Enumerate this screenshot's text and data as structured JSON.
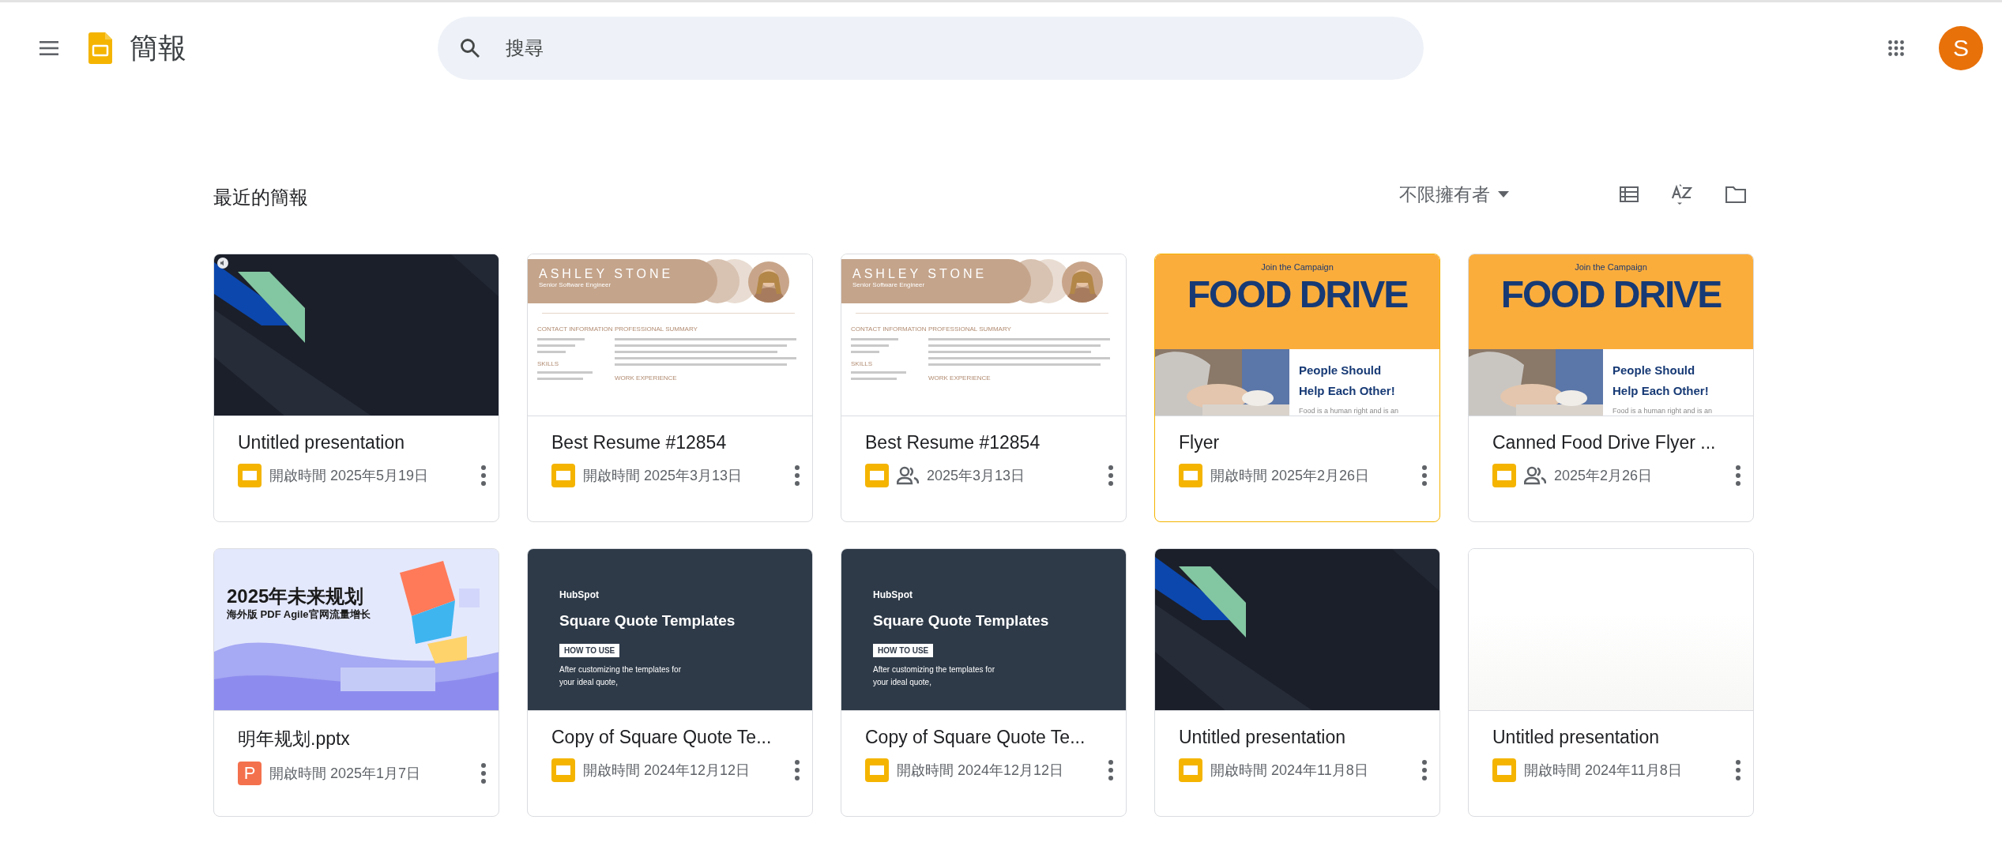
{
  "app": {
    "title": "簡報"
  },
  "search": {
    "placeholder": "搜尋"
  },
  "avatar": {
    "letter": "S",
    "color": "#e8710a"
  },
  "section": {
    "title": "最近的簡報",
    "owner_filter": "不限擁有者"
  },
  "cards": [
    {
      "title": "Untitled presentation",
      "kind": "slides",
      "shared": false,
      "date": "開啟時間 2025年5月19日",
      "selected": false,
      "thumbnail": {
        "kind": "dark",
        "audio": true
      }
    },
    {
      "title": "Best Resume #12854",
      "kind": "slides",
      "shared": false,
      "date": "開啟時間 2025年3月13日",
      "selected": false,
      "thumbnail": {
        "kind": "resume",
        "name": "ASHLEY STONE",
        "subtitle": "Senior Software Engineer",
        "left_heading": "CONTACT INFORMATION",
        "right_heading": "PROFESSIONAL SUMMARY",
        "skills": "SKILLS",
        "work": "WORK EXPERIENCE"
      }
    },
    {
      "title": "Best Resume #12854",
      "kind": "slides",
      "shared": true,
      "date": "2025年3月13日",
      "selected": false,
      "thumbnail": {
        "kind": "resume",
        "name": "ASHLEY STONE",
        "subtitle": "Senior Software Engineer",
        "left_heading": "CONTACT INFORMATION",
        "right_heading": "PROFESSIONAL SUMMARY",
        "skills": "SKILLS",
        "work": "WORK EXPERIENCE"
      }
    },
    {
      "title": "Flyer",
      "kind": "slides",
      "shared": false,
      "date": "開啟時間 2025年2月26日",
      "selected": true,
      "thumbnail": {
        "kind": "flyer",
        "kicker": "Join the Campaign",
        "headline": "FOOD DRIVE",
        "lines": [
          "People Should",
          "Help Each Other!"
        ],
        "body": "Food is a human right and is an"
      }
    },
    {
      "title": "Canned Food Drive Flyer ...",
      "kind": "slides",
      "shared": true,
      "date": "2025年2月26日",
      "selected": false,
      "thumbnail": {
        "kind": "flyer",
        "kicker": "Join the Campaign",
        "headline": "FOOD DRIVE",
        "lines": [
          "People Should",
          "Help Each Other!"
        ],
        "body": "Food is a human right and is an"
      }
    },
    {
      "title": "明年规划.pptx",
      "kind": "pptx",
      "file_letter": "P",
      "shared": false,
      "date": "開啟時間 2025年1月7日",
      "selected": false,
      "thumbnail": {
        "kind": "plan",
        "headline": "2025年未来规划",
        "subtitle": "海外版 PDF Agile官网流量增长"
      }
    },
    {
      "title": "Copy of Square Quote Te...",
      "kind": "slides",
      "shared": false,
      "date": "開啟時間 2024年12月12日",
      "selected": false,
      "thumbnail": {
        "kind": "quote",
        "brand": "HubSpot",
        "headline": "Square Quote Templates",
        "tag": "HOW TO USE",
        "body": "After customizing the templates for your ideal quote,"
      }
    },
    {
      "title": "Copy of Square Quote Te...",
      "kind": "slides",
      "shared": false,
      "date": "開啟時間 2024年12月12日",
      "selected": false,
      "thumbnail": {
        "kind": "quote",
        "brand": "HubSpot",
        "headline": "Square Quote Templates",
        "tag": "HOW TO USE",
        "body": "After customizing the templates for your ideal quote,"
      }
    },
    {
      "title": "Untitled presentation",
      "kind": "slides",
      "shared": false,
      "date": "開啟時間 2024年11月8日",
      "selected": false,
      "thumbnail": {
        "kind": "dark",
        "audio": false
      }
    },
    {
      "title": "Untitled presentation",
      "kind": "slides",
      "shared": false,
      "date": "開啟時間 2024年11月8日",
      "selected": false,
      "thumbnail": {
        "kind": "blank"
      }
    }
  ]
}
